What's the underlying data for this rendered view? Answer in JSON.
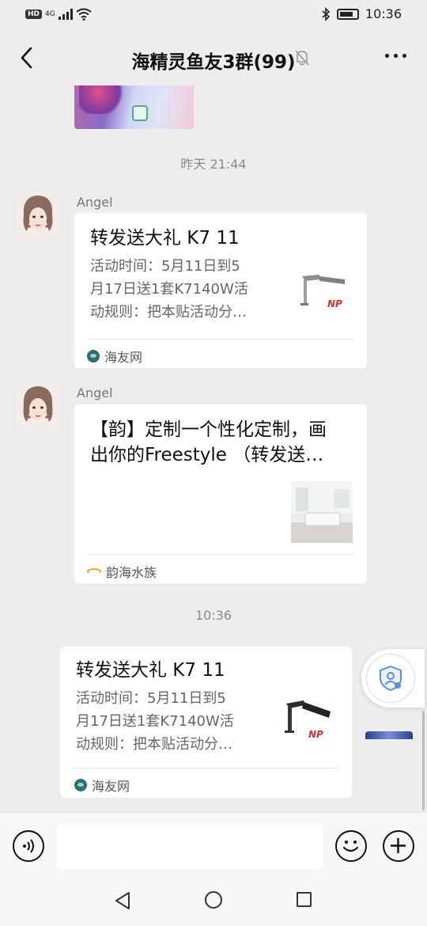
{
  "status_bar": {
    "network_badge": "HD",
    "network_type": "4G",
    "time": "10:36",
    "icons": [
      "signal-icon",
      "wifi-icon",
      "bluetooth-icon",
      "battery-icon"
    ]
  },
  "header": {
    "title": "海精灵鱼友3群(99)",
    "icons": [
      "back-chevron-icon",
      "mute-bell-icon",
      "more-dots-icon"
    ]
  },
  "messages": [
    {
      "timestamp": "昨天 21:44",
      "sender": "Angel",
      "card": {
        "title": "转发送大礼 K7 11",
        "description": "活动时间：5月11日到5月17日送1套K7140W活动规则：把本贴活动分…",
        "description_lines": [
          "活动时间：5月11日到5",
          "月17日送1套K7140W活",
          "动规则：把本贴活动分…"
        ],
        "thumbnail_caption": "NP",
        "source": "海友网"
      }
    },
    {
      "sender": "Angel",
      "card": {
        "title": "【韵】定制一个性化定制，画出你的Freestyle （转发送…",
        "title_lines": [
          "【韵】定制一个性化定制，画",
          "出你的Freestyle （转发送…"
        ],
        "source": "韵海水族"
      }
    },
    {
      "timestamp": "10:36",
      "sender": "me",
      "card": {
        "title": "转发送大礼 K7 11",
        "description": "活动时间：5月11日到5月17日送1套K7140W活动规则：把本贴活动分…",
        "description_lines": [
          "活动时间：5月11日到5",
          "月17日送1套K7140W活",
          "动规则：把本贴活动分…"
        ],
        "thumbnail_caption": "NP",
        "source": "海友网"
      }
    }
  ],
  "input_bar": {
    "placeholder": "",
    "icons": [
      "voice-icon",
      "emoji-icon",
      "plus-icon"
    ]
  },
  "system_nav": {
    "icons": [
      "nav-back-icon",
      "nav-home-icon",
      "nav-recent-icon"
    ]
  },
  "colors": {
    "background": "#ededed",
    "card": "#ffffff",
    "secondary_text": "#8a8a8a",
    "float_icon_blue": "#5b8fd6"
  }
}
